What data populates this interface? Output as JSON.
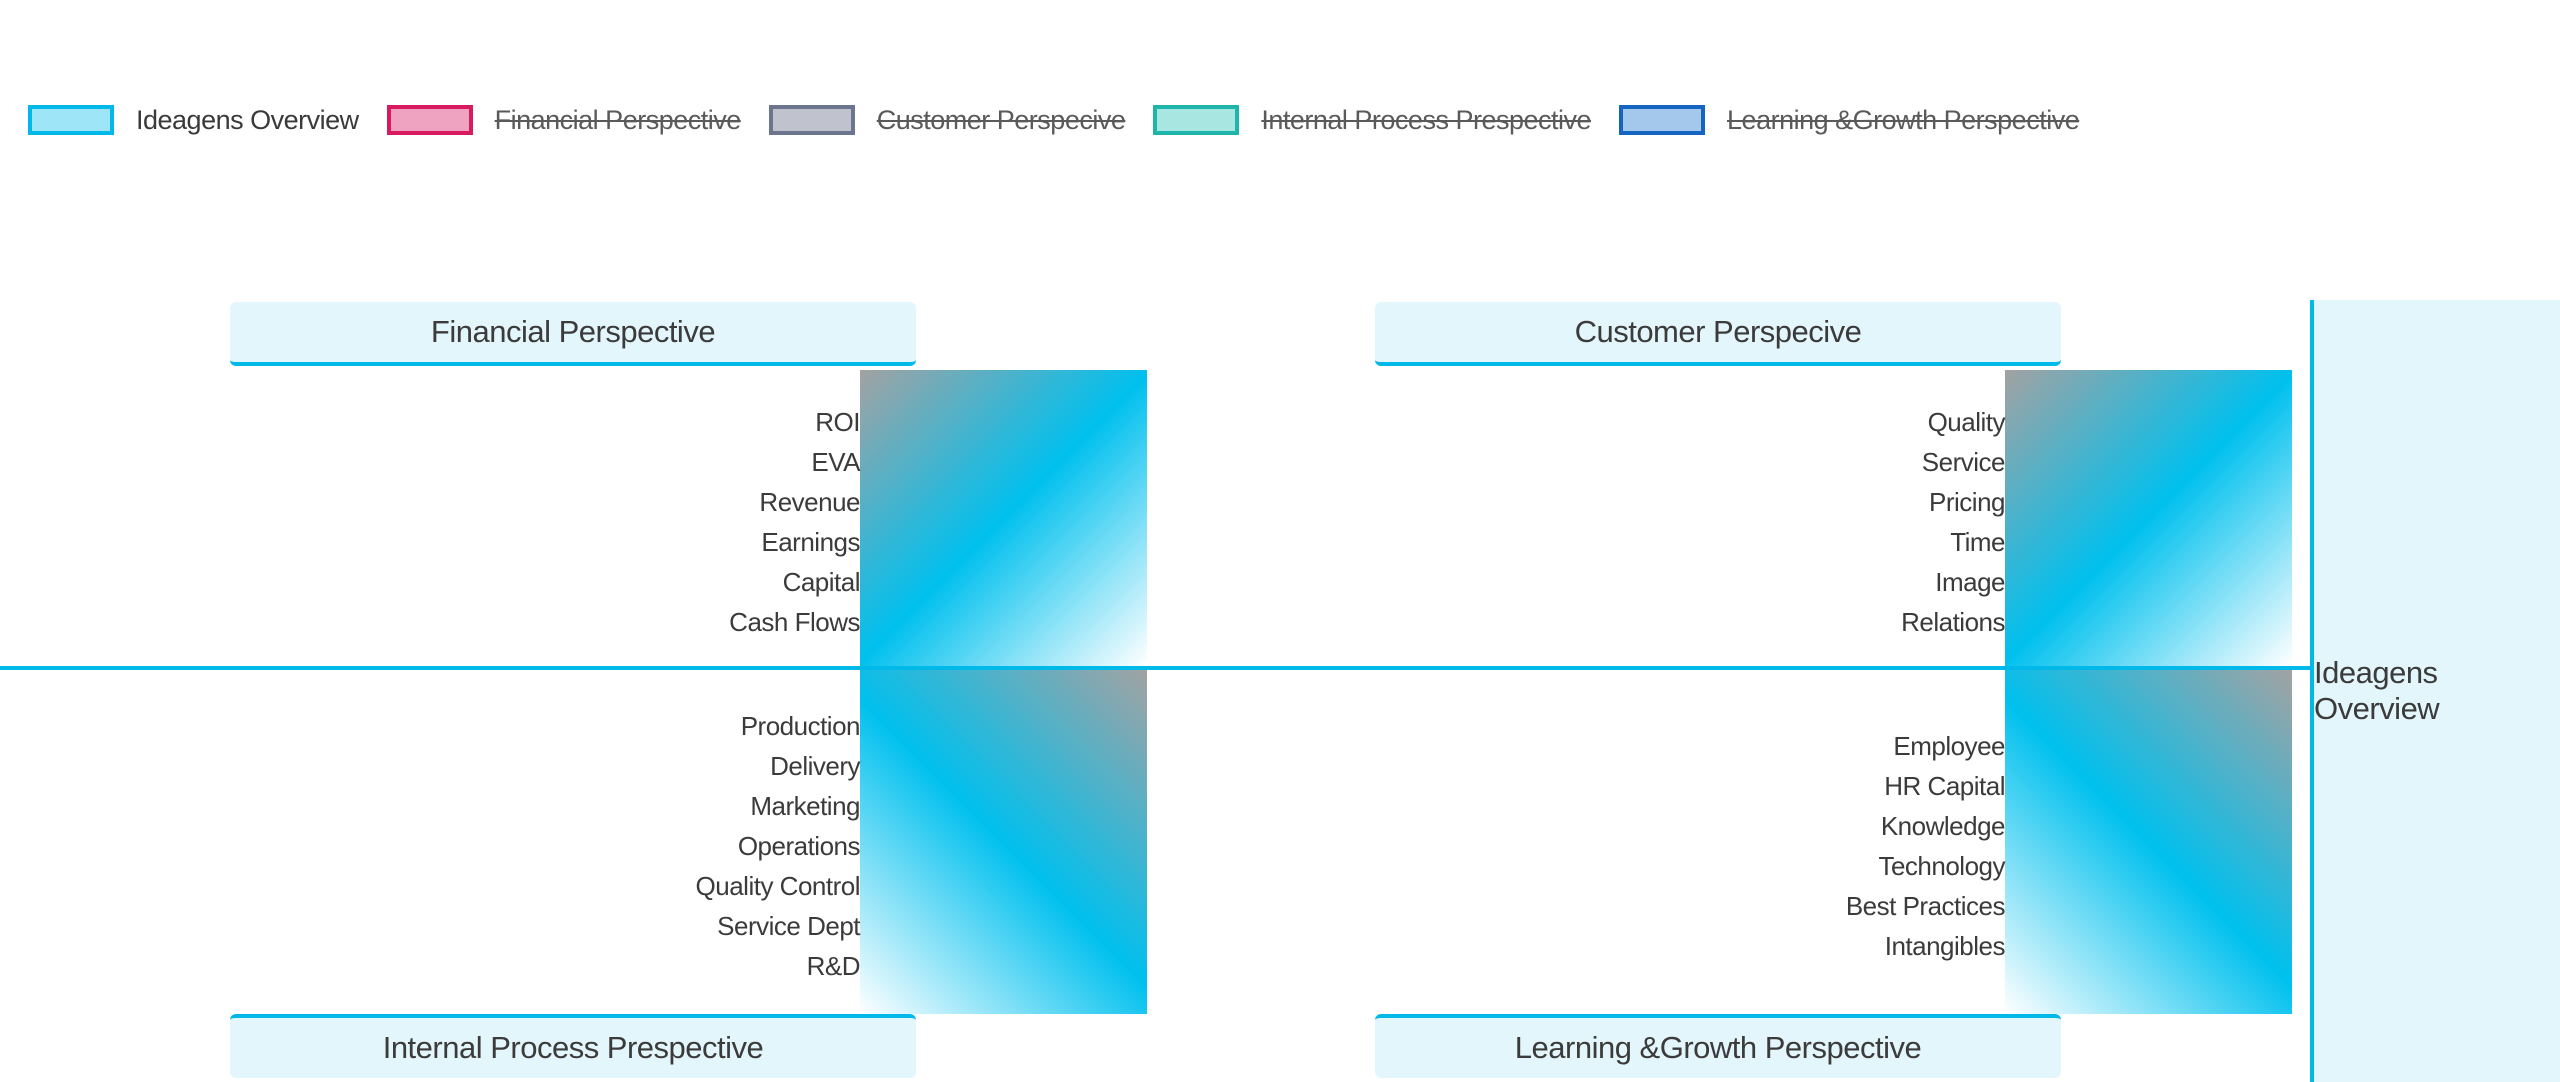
{
  "legend": [
    {
      "label": "Ideagens Overview",
      "fill": "#9ee6f7",
      "stroke": "#00b9e8",
      "active": true
    },
    {
      "label": "Financial Perspective",
      "fill": "#f0a3c0",
      "stroke": "#d81b60",
      "active": false
    },
    {
      "label": "Customer Perspecive",
      "fill": "#c0c3ce",
      "stroke": "#6b7590",
      "active": false
    },
    {
      "label": "Internal Process Prespective",
      "fill": "#a8e6e2",
      "stroke": "#1fb5ad",
      "active": false
    },
    {
      "label": "Learning &Growth Perspective",
      "fill": "#a3c8ec",
      "stroke": "#1565c0",
      "active": false
    }
  ],
  "overview": {
    "label": "Ideagens Overview"
  },
  "quadrants": {
    "financial": {
      "title": "Financial Perspective",
      "items": [
        "ROI",
        "EVA",
        "Revenue",
        "Earnings",
        "Capital",
        "Cash Flows"
      ]
    },
    "customer": {
      "title": "Customer Perspecive",
      "items": [
        "Quality",
        "Service",
        "Pricing",
        "Time",
        "Image",
        "Relations"
      ]
    },
    "internal": {
      "title": "Internal Process Prespective",
      "items": [
        "Production",
        "Delivery",
        "Marketing",
        "Operations",
        "Quality Control",
        "Service Dept",
        "R&D"
      ]
    },
    "learning": {
      "title": "Learning &Growth Perspective",
      "items": [
        "Employee",
        "HR Capital",
        "Knowledge",
        "Technology",
        "Best Practices",
        "Intangibles"
      ]
    }
  }
}
